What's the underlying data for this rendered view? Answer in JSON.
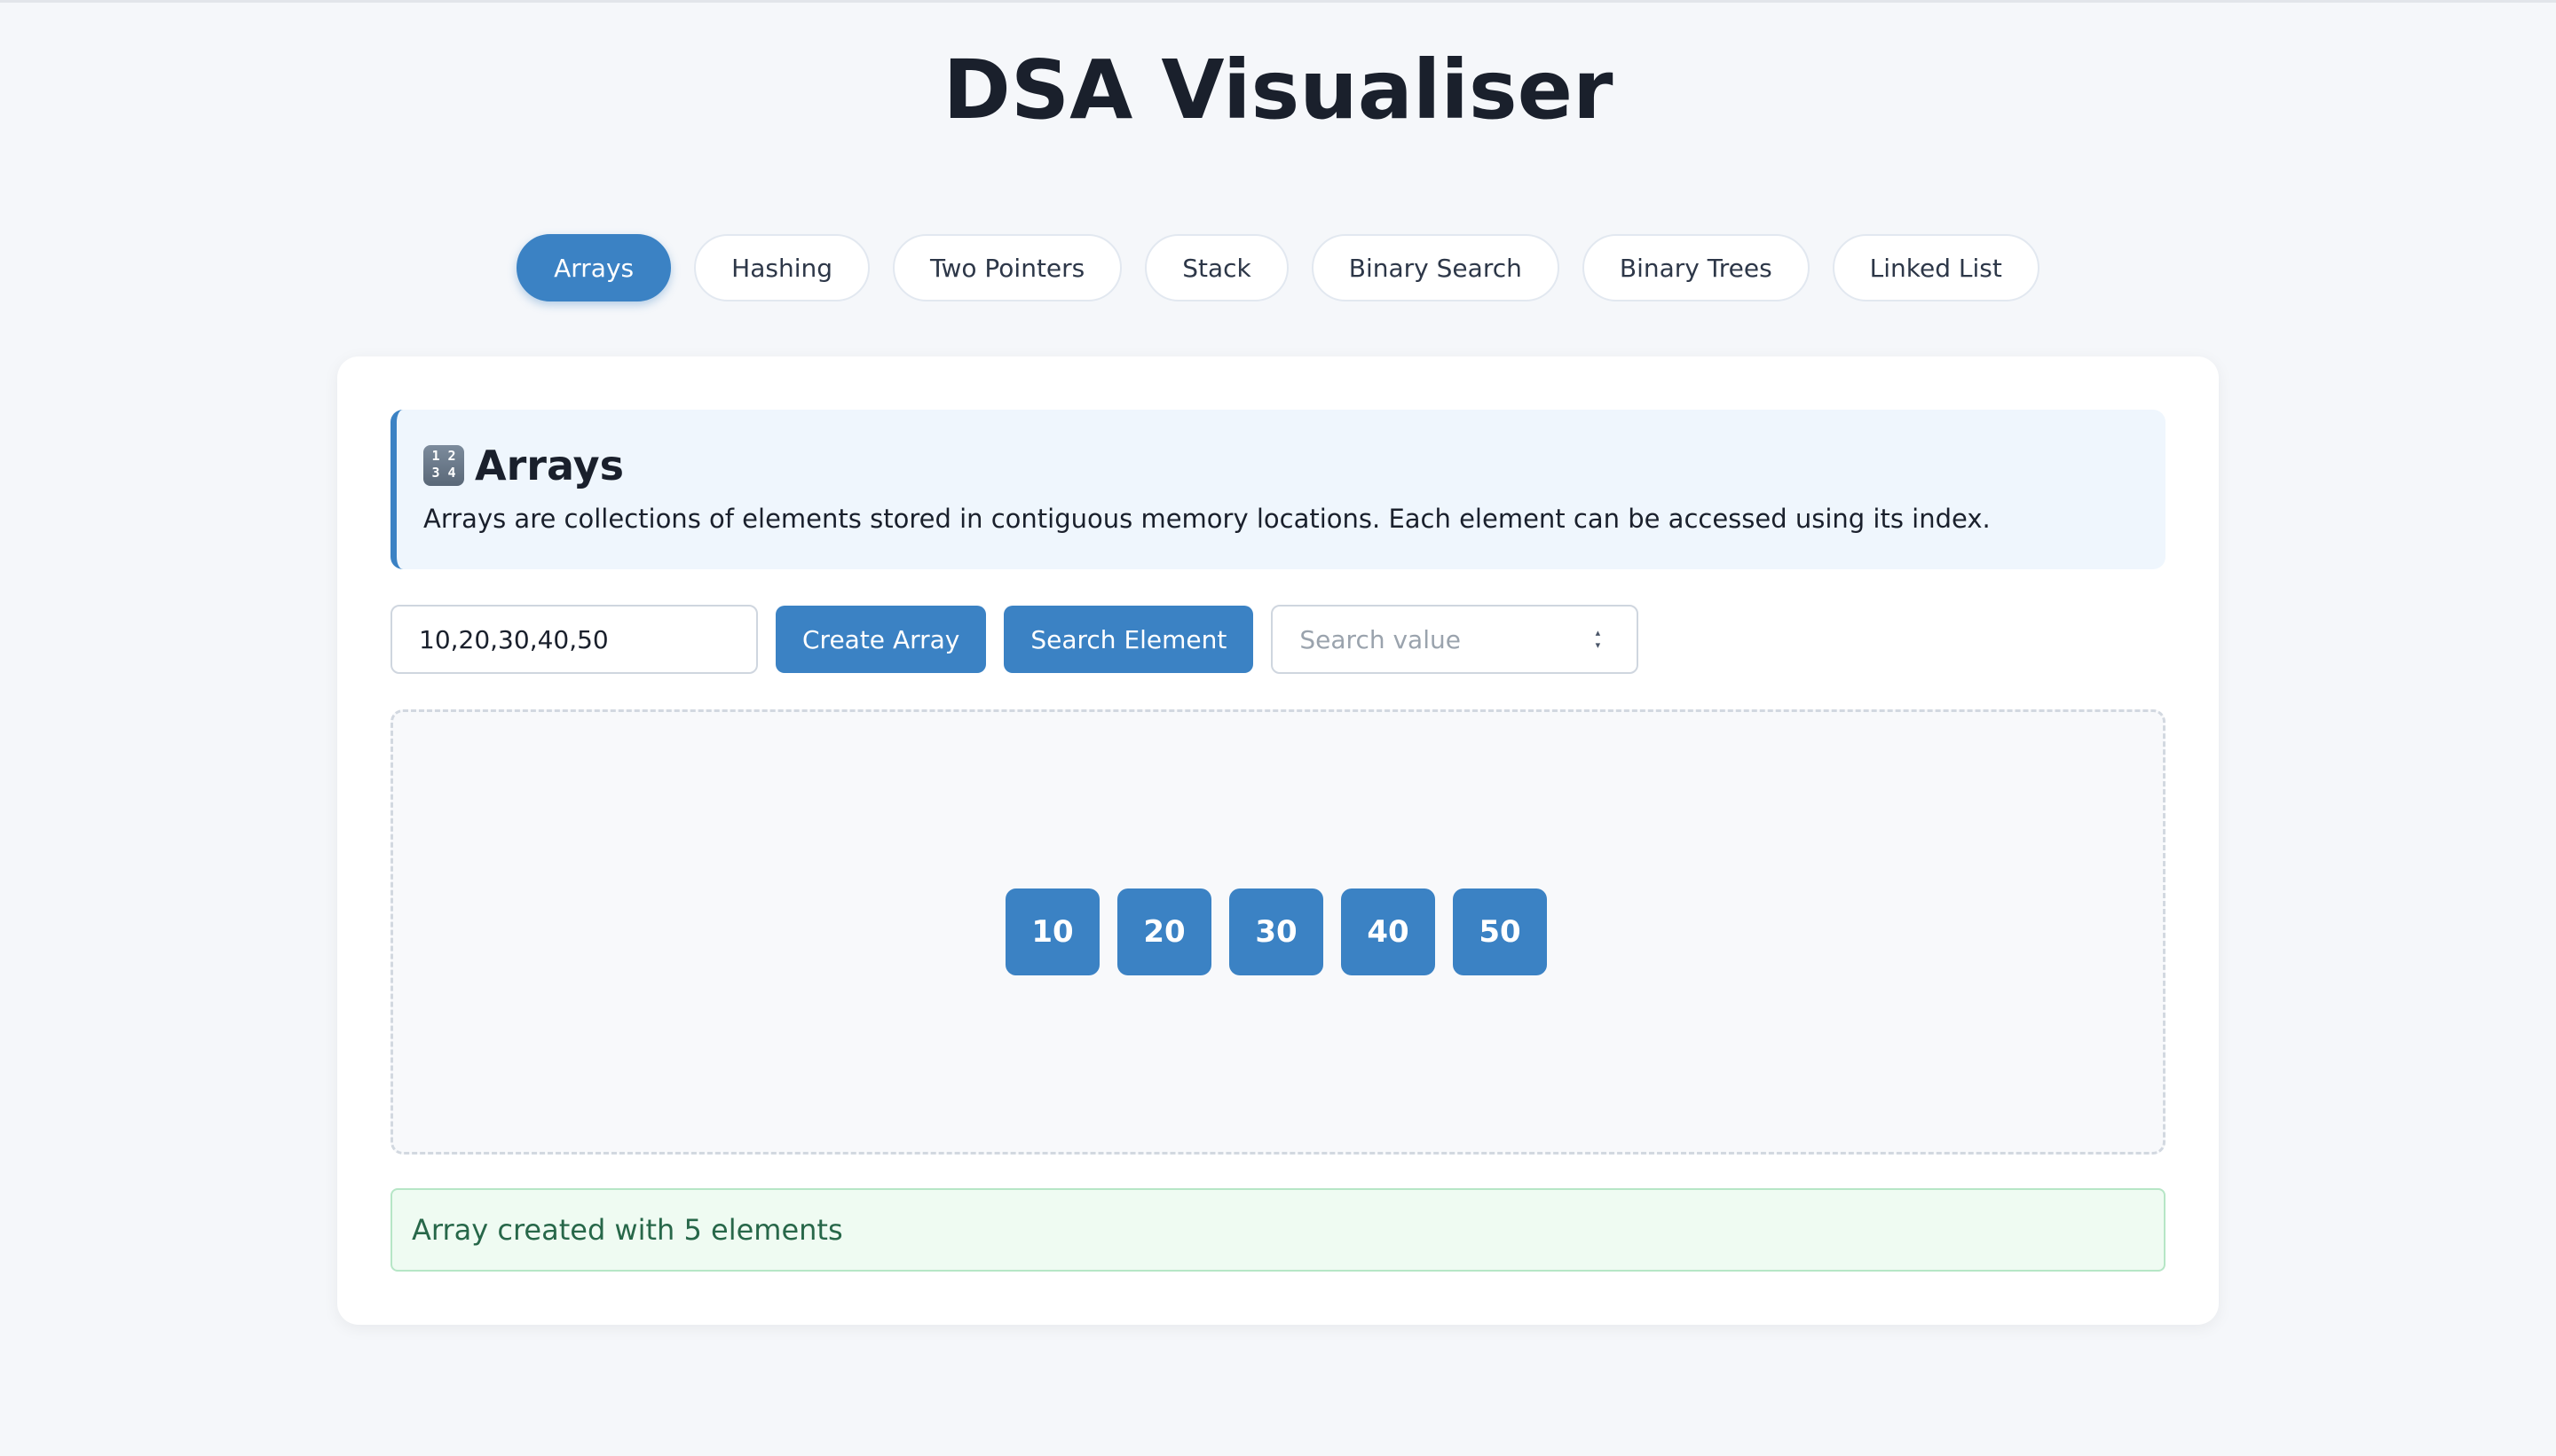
{
  "app": {
    "title": "DSA Visualiser"
  },
  "tabs": [
    {
      "label": "Arrays",
      "active": true
    },
    {
      "label": "Hashing",
      "active": false
    },
    {
      "label": "Two Pointers",
      "active": false
    },
    {
      "label": "Stack",
      "active": false
    },
    {
      "label": "Binary Search",
      "active": false
    },
    {
      "label": "Binary Trees",
      "active": false
    },
    {
      "label": "Linked List",
      "active": false
    }
  ],
  "section": {
    "icon": "input-numbers-icon",
    "icon_glyph_top": "1 2",
    "icon_glyph_bottom": "3 4",
    "heading": "Arrays",
    "description": "Arrays are collections of elements stored in contiguous memory locations. Each element can be accessed using its index."
  },
  "controls": {
    "array_input_value": "10,20,30,40,50",
    "create_label": "Create Array",
    "search_label": "Search Element",
    "search_placeholder": "Search value"
  },
  "array": [
    "10",
    "20",
    "30",
    "40",
    "50"
  ],
  "status": {
    "message": "Array created with 5 elements"
  },
  "colors": {
    "accent": "#3b82c4",
    "background": "#f5f7fa",
    "status_bg": "#effbf2",
    "status_text": "#276749"
  }
}
